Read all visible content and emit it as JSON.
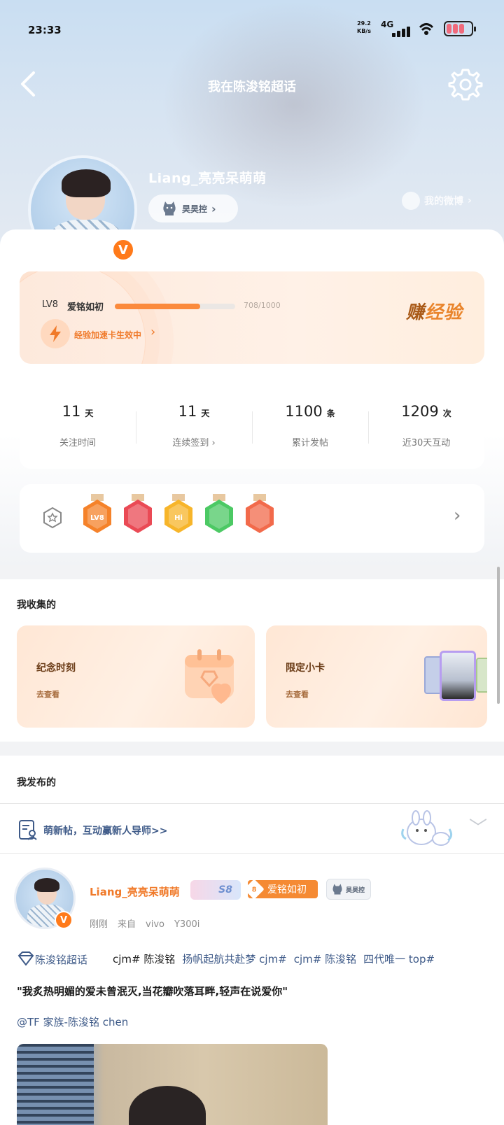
{
  "status_bar": {
    "time": "23:33",
    "net_speed_value": "29.2",
    "net_speed_unit": "KB/s",
    "network": "4G"
  },
  "header": {
    "title": "我在陈浚铭超话"
  },
  "profile": {
    "username": "Liang_亮亮呆萌萌",
    "fan_badge": "昊昊控",
    "my_weibo": "我的微博"
  },
  "level": {
    "lv": "LV8",
    "name": "爱铭如初",
    "progress_text": "708/1000",
    "progress_fraction": 0.708,
    "boost_text": "经验加速卡生效中",
    "earn_prefix": "赚",
    "earn_suffix": "经验"
  },
  "stats": [
    {
      "value": "11",
      "unit": "天",
      "label": "关注时间"
    },
    {
      "value": "11",
      "unit": "天",
      "label": "连续签到"
    },
    {
      "value": "1100",
      "unit": "条",
      "label": "累计发帖"
    },
    {
      "value": "1209",
      "unit": "次",
      "label": "近30天互动"
    }
  ],
  "medals": {
    "items": [
      {
        "icon": "lv8-medal-icon",
        "color": "#f5822a",
        "text": "LV8"
      },
      {
        "icon": "trophy-medal-icon",
        "color": "#ea4a55",
        "text": ""
      },
      {
        "icon": "hi-medal-icon",
        "color": "#f7b52a",
        "text": "Hi"
      },
      {
        "icon": "hand-medal-icon",
        "color": "#4cc964",
        "text": ""
      },
      {
        "icon": "badge-medal-icon",
        "color": "#f26a4b",
        "text": ""
      }
    ]
  },
  "collections": {
    "title": "我收集的",
    "cards": [
      {
        "title": "纪念时刻",
        "action": "去查看"
      },
      {
        "title": "限定小卡",
        "action": "去查看"
      }
    ]
  },
  "posted": {
    "title": "我发布的",
    "newbie_text": "萌新帖，互动赢新人导师>>"
  },
  "post": {
    "author": "Liang_亮亮呆萌萌",
    "tag_s8": "S8",
    "tag_level_num": "8",
    "tag_level_name": "爱铭如初",
    "tag_fan": "昊昊控",
    "time": "刚刚",
    "source_prefix": "来自",
    "device": "vivo",
    "model": "Y300i",
    "topic_chip": "陈浚铭超话",
    "topics": [
      "cjm# 陈浚铭",
      "扬帆起航共赴梦 cjm#",
      "cjm# 陈浚铭",
      "四代唯一 top#"
    ],
    "quote": "\"我炙热明媚的爱未曾泯灭,当花瓣吹落耳畔,轻声在说爱你\"",
    "mention": "@TF 家族-陈浚铭 chen"
  },
  "colors": {
    "accent_orange": "#f07a2a",
    "link_blue": "#3e5a88"
  }
}
